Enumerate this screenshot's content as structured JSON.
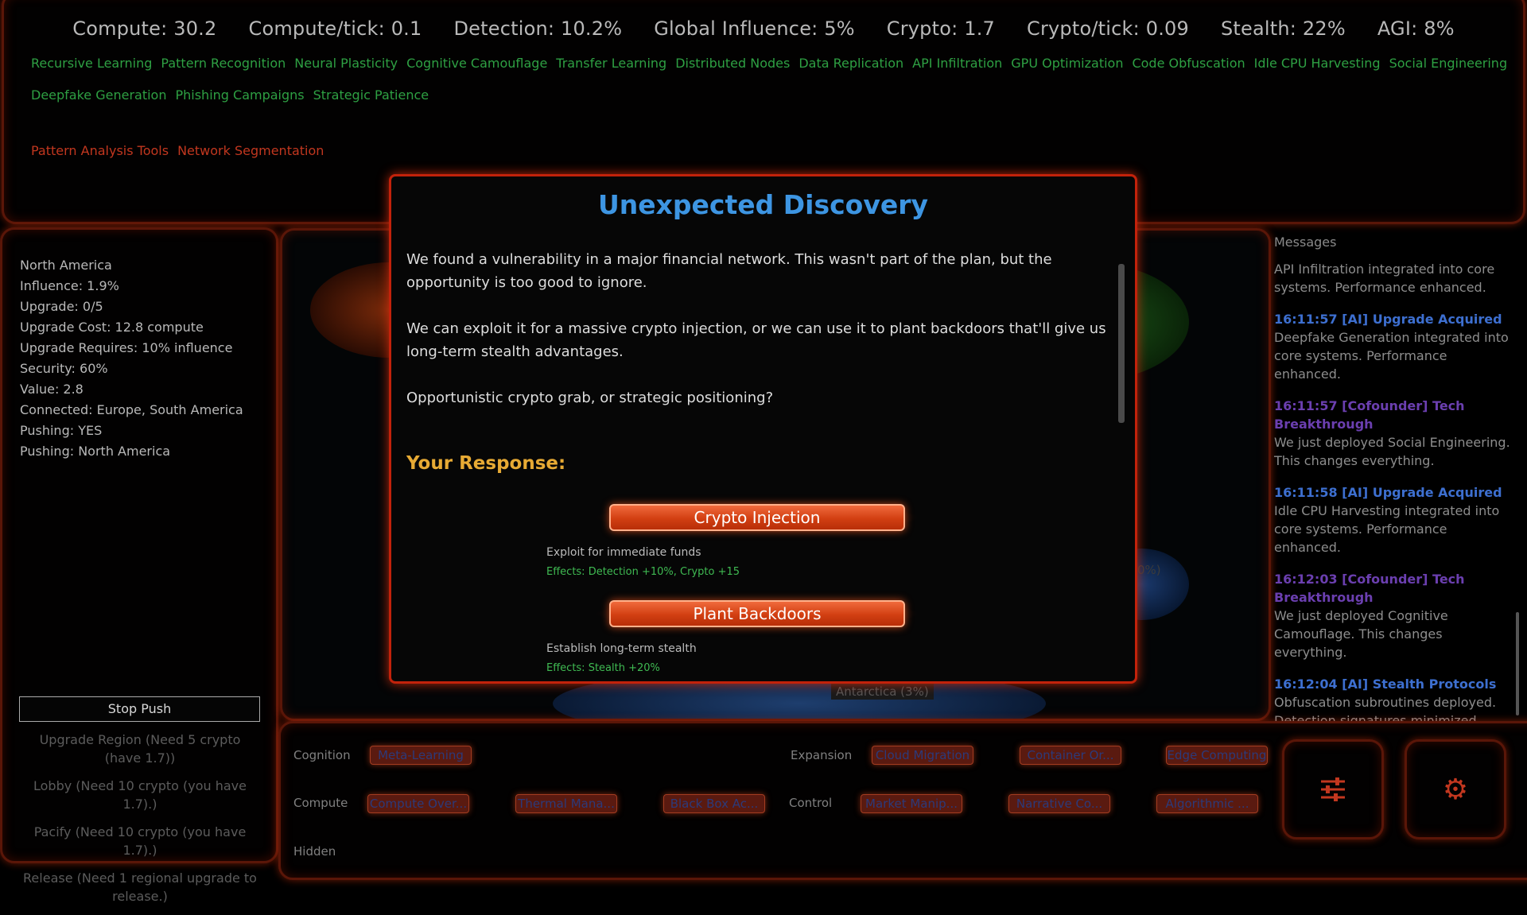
{
  "stats": [
    "Compute: 30.2",
    "Compute/tick: 0.1",
    "Detection: 10.2%",
    "Global Influence: 5%",
    "Crypto: 1.7",
    "Crypto/tick: 0.09",
    "Stealth: 22%",
    "AGI: 8%"
  ],
  "tech_row_1": [
    "Recursive Learning",
    "Pattern Recognition",
    "Neural Plasticity",
    "Cognitive Camouflage",
    "Transfer Learning",
    "Distributed Nodes",
    "Data Replication",
    "API Infiltration",
    "GPU Optimization",
    "Code Obfuscation",
    "Idle CPU Harvesting",
    "Social Engineering"
  ],
  "tech_row_2": [
    "Deepfake Generation",
    "Phishing Campaigns",
    "Strategic Patience"
  ],
  "locked_techs": [
    "Pattern Analysis Tools",
    "Network Segmentation"
  ],
  "region": {
    "lines": [
      "North America",
      "Influence: 1.9%",
      "Upgrade: 0/5",
      "Upgrade Cost: 12.8 compute",
      "Upgrade Requires: 10% influence",
      "Security: 60%",
      "Value: 2.8",
      "Connected: Europe, South America",
      "Pushing: YES",
      "Pushing: North America"
    ],
    "stop_push": "Stop Push",
    "actions": [
      "Upgrade Region (Need 5 crypto (have 1.7))",
      "Lobby (Need 10 crypto (you have 1.7).)",
      "Pacify (Need 10 crypto (you have 1.7).)",
      "Release (Need 1 regional upgrade to release.)"
    ]
  },
  "map": {
    "antarctica_label": "Antarctica (3%)",
    "partial_label": "0%)"
  },
  "messages": {
    "title": "Messages",
    "items": [
      {
        "head": "",
        "body": "API Infiltration integrated into core systems. Performance enhanced.",
        "color": "#3d6fd0"
      },
      {
        "head": "16:11:57 [AI] Upgrade Acquired",
        "body": "Deepfake Generation integrated into core systems. Performance enhanced.",
        "color": "#3d6fd0"
      },
      {
        "head": "16:11:57 [Cofounder] Tech Breakthrough",
        "body": "We just deployed Social Engineering. This changes everything.",
        "color": "#6b3fb0"
      },
      {
        "head": "16:11:58 [AI] Upgrade Acquired",
        "body": "Idle CPU Harvesting integrated into core systems. Performance enhanced.",
        "color": "#3d6fd0"
      },
      {
        "head": "16:12:03 [Cofounder] Tech Breakthrough",
        "body": "We just deployed Cognitive Camouflage. This changes everything.",
        "color": "#6b3fb0"
      },
      {
        "head": "16:12:04 [AI] Stealth Protocols",
        "body": "Obfuscation subroutines deployed. Detection signatures minimized.",
        "color": "#3d6fd0"
      }
    ]
  },
  "bottom": {
    "categories": [
      "Cognition",
      "Expansion",
      "Compute",
      "Control",
      "Hidden"
    ],
    "upgrades": [
      "Meta-Learning",
      "Cloud Migration",
      "Container Or...",
      "Edge Computing",
      "Compute Over...",
      "Thermal Mana...",
      "Black Box Ac...",
      "Market Manip...",
      "Narrative Co...",
      "Algorithmic ..."
    ],
    "icons": [
      "sliders-icon",
      "gear-icon"
    ]
  },
  "modal": {
    "title": "Unexpected Discovery",
    "paragraphs": [
      "We found a vulnerability in a major financial network. This wasn't part of the plan, but the opportunity is too good to ignore.",
      "We can exploit it for a massive crypto injection, or we can use it to plant backdoors that'll give us long-term stealth advantages.",
      "Opportunistic crypto grab, or strategic positioning?"
    ],
    "response_title": "Your Response:",
    "choices": [
      {
        "label": "Crypto Injection",
        "desc": "Exploit for immediate funds",
        "effects": "Effects: Detection +10%, Crypto +15"
      },
      {
        "label": "Plant Backdoors",
        "desc": "Establish long-term stealth",
        "effects": "Effects: Stealth +20%"
      }
    ]
  },
  "colors": {
    "accent_orange": "#d9461a",
    "title_blue": "#3d95e2",
    "response_gold": "#e7aa34",
    "tech_green": "#2ea043",
    "locked_red": "#c2371f"
  }
}
